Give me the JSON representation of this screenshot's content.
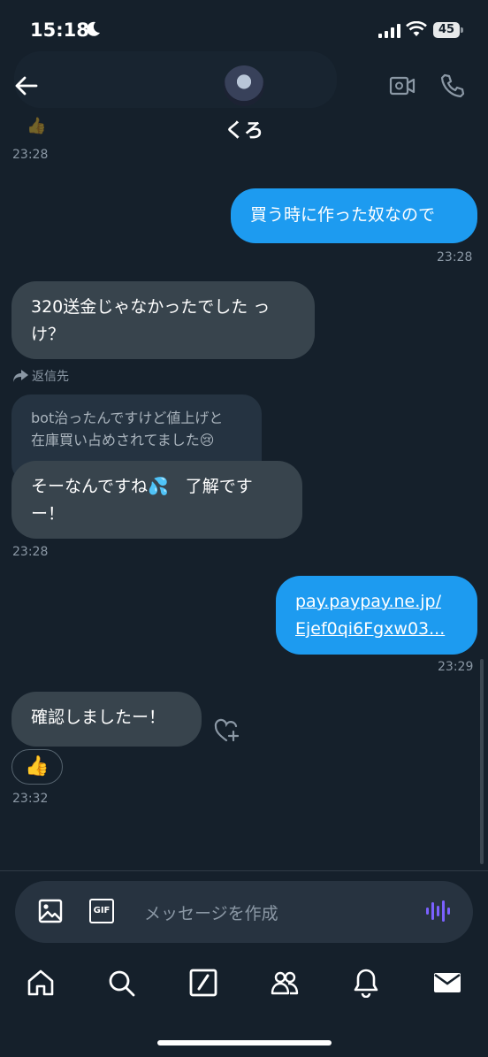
{
  "status_bar": {
    "time": "15:18",
    "battery": "45"
  },
  "header": {
    "contact_name": "くろ"
  },
  "messages": {
    "m0_time": "23:28",
    "m1_text": "買う時に作った奴なので",
    "m1_time": "23:28",
    "m2_line1": "320送金じゃなかったでした っ",
    "m2_line2": "け？",
    "reply_label": "返信先",
    "quoted_line1": "bot治ったんですけど値上げと",
    "quoted_line2": "在庫買い占めされてました😢",
    "m3_line1": "そーなんですね💦　了解です",
    "m3_line2": "ー！",
    "m3_time": "23:28",
    "m4_line1": "pay.paypay.ne.jp/",
    "m4_line2": "Ejef0qi6Fgxw03...",
    "m4_time": "23:29",
    "m5_text": "確認しましたー！",
    "m5_reaction": "👍",
    "m5_time": "23:32"
  },
  "composer": {
    "placeholder": "メッセージを作成",
    "gif_label": "GIF"
  },
  "colors": {
    "background": "#15202b",
    "incoming_bubble": "#38444d",
    "outgoing_bubble": "#1d9bf0",
    "mic_accent": "#7b61ff"
  },
  "icons": {
    "header": [
      "back-arrow-icon",
      "video-call-icon",
      "phone-icon"
    ],
    "composer": [
      "image-icon",
      "gif-icon",
      "voice-icon"
    ],
    "tabs": [
      "home-icon",
      "search-icon",
      "compose-icon",
      "communities-icon",
      "notifications-icon",
      "messages-icon"
    ]
  }
}
